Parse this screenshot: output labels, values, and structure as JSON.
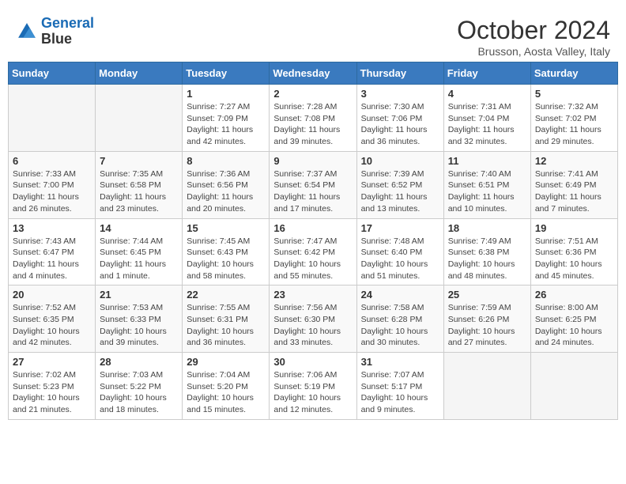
{
  "header": {
    "logo_line1": "General",
    "logo_line2": "Blue",
    "month": "October 2024",
    "location": "Brusson, Aosta Valley, Italy"
  },
  "weekdays": [
    "Sunday",
    "Monday",
    "Tuesday",
    "Wednesday",
    "Thursday",
    "Friday",
    "Saturday"
  ],
  "weeks": [
    [
      {
        "day": "",
        "info": ""
      },
      {
        "day": "",
        "info": ""
      },
      {
        "day": "1",
        "info": "Sunrise: 7:27 AM\nSunset: 7:09 PM\nDaylight: 11 hours and 42 minutes."
      },
      {
        "day": "2",
        "info": "Sunrise: 7:28 AM\nSunset: 7:08 PM\nDaylight: 11 hours and 39 minutes."
      },
      {
        "day": "3",
        "info": "Sunrise: 7:30 AM\nSunset: 7:06 PM\nDaylight: 11 hours and 36 minutes."
      },
      {
        "day": "4",
        "info": "Sunrise: 7:31 AM\nSunset: 7:04 PM\nDaylight: 11 hours and 32 minutes."
      },
      {
        "day": "5",
        "info": "Sunrise: 7:32 AM\nSunset: 7:02 PM\nDaylight: 11 hours and 29 minutes."
      }
    ],
    [
      {
        "day": "6",
        "info": "Sunrise: 7:33 AM\nSunset: 7:00 PM\nDaylight: 11 hours and 26 minutes."
      },
      {
        "day": "7",
        "info": "Sunrise: 7:35 AM\nSunset: 6:58 PM\nDaylight: 11 hours and 23 minutes."
      },
      {
        "day": "8",
        "info": "Sunrise: 7:36 AM\nSunset: 6:56 PM\nDaylight: 11 hours and 20 minutes."
      },
      {
        "day": "9",
        "info": "Sunrise: 7:37 AM\nSunset: 6:54 PM\nDaylight: 11 hours and 17 minutes."
      },
      {
        "day": "10",
        "info": "Sunrise: 7:39 AM\nSunset: 6:52 PM\nDaylight: 11 hours and 13 minutes."
      },
      {
        "day": "11",
        "info": "Sunrise: 7:40 AM\nSunset: 6:51 PM\nDaylight: 11 hours and 10 minutes."
      },
      {
        "day": "12",
        "info": "Sunrise: 7:41 AM\nSunset: 6:49 PM\nDaylight: 11 hours and 7 minutes."
      }
    ],
    [
      {
        "day": "13",
        "info": "Sunrise: 7:43 AM\nSunset: 6:47 PM\nDaylight: 11 hours and 4 minutes."
      },
      {
        "day": "14",
        "info": "Sunrise: 7:44 AM\nSunset: 6:45 PM\nDaylight: 11 hours and 1 minute."
      },
      {
        "day": "15",
        "info": "Sunrise: 7:45 AM\nSunset: 6:43 PM\nDaylight: 10 hours and 58 minutes."
      },
      {
        "day": "16",
        "info": "Sunrise: 7:47 AM\nSunset: 6:42 PM\nDaylight: 10 hours and 55 minutes."
      },
      {
        "day": "17",
        "info": "Sunrise: 7:48 AM\nSunset: 6:40 PM\nDaylight: 10 hours and 51 minutes."
      },
      {
        "day": "18",
        "info": "Sunrise: 7:49 AM\nSunset: 6:38 PM\nDaylight: 10 hours and 48 minutes."
      },
      {
        "day": "19",
        "info": "Sunrise: 7:51 AM\nSunset: 6:36 PM\nDaylight: 10 hours and 45 minutes."
      }
    ],
    [
      {
        "day": "20",
        "info": "Sunrise: 7:52 AM\nSunset: 6:35 PM\nDaylight: 10 hours and 42 minutes."
      },
      {
        "day": "21",
        "info": "Sunrise: 7:53 AM\nSunset: 6:33 PM\nDaylight: 10 hours and 39 minutes."
      },
      {
        "day": "22",
        "info": "Sunrise: 7:55 AM\nSunset: 6:31 PM\nDaylight: 10 hours and 36 minutes."
      },
      {
        "day": "23",
        "info": "Sunrise: 7:56 AM\nSunset: 6:30 PM\nDaylight: 10 hours and 33 minutes."
      },
      {
        "day": "24",
        "info": "Sunrise: 7:58 AM\nSunset: 6:28 PM\nDaylight: 10 hours and 30 minutes."
      },
      {
        "day": "25",
        "info": "Sunrise: 7:59 AM\nSunset: 6:26 PM\nDaylight: 10 hours and 27 minutes."
      },
      {
        "day": "26",
        "info": "Sunrise: 8:00 AM\nSunset: 6:25 PM\nDaylight: 10 hours and 24 minutes."
      }
    ],
    [
      {
        "day": "27",
        "info": "Sunrise: 7:02 AM\nSunset: 5:23 PM\nDaylight: 10 hours and 21 minutes."
      },
      {
        "day": "28",
        "info": "Sunrise: 7:03 AM\nSunset: 5:22 PM\nDaylight: 10 hours and 18 minutes."
      },
      {
        "day": "29",
        "info": "Sunrise: 7:04 AM\nSunset: 5:20 PM\nDaylight: 10 hours and 15 minutes."
      },
      {
        "day": "30",
        "info": "Sunrise: 7:06 AM\nSunset: 5:19 PM\nDaylight: 10 hours and 12 minutes."
      },
      {
        "day": "31",
        "info": "Sunrise: 7:07 AM\nSunset: 5:17 PM\nDaylight: 10 hours and 9 minutes."
      },
      {
        "day": "",
        "info": ""
      },
      {
        "day": "",
        "info": ""
      }
    ]
  ]
}
